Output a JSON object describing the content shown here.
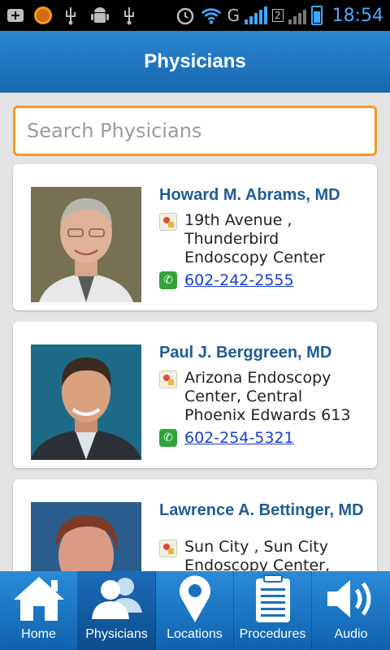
{
  "status_bar": {
    "time": "18:54",
    "network_label": "G",
    "sim_label": "2"
  },
  "header": {
    "title": "Physicians"
  },
  "search": {
    "placeholder": "Search Physicians",
    "value": ""
  },
  "physicians": [
    {
      "name": "Howard M. Abrams, MD",
      "address": "19th Avenue , Thunderbird Endoscopy Center",
      "phone": "602-242-2555"
    },
    {
      "name": "Paul J. Berggreen, MD",
      "address": "Arizona Endoscopy Center, Central Phoenix Edwards 613",
      "phone": "602-254-5321"
    },
    {
      "name": "Lawrence A. Bettinger, MD",
      "address": "Sun City , Sun City Endoscopy Center,",
      "phone": ""
    }
  ],
  "tabs": [
    {
      "label": "Home",
      "icon": "home-icon"
    },
    {
      "label": "Physicians",
      "icon": "people-icon"
    },
    {
      "label": "Locations",
      "icon": "location-pin-icon"
    },
    {
      "label": "Procedures",
      "icon": "clipboard-icon"
    },
    {
      "label": "Audio",
      "icon": "speaker-icon"
    }
  ],
  "colors": {
    "header": "#1f77c4",
    "search_border": "#f29a22",
    "name_text": "#1f5c96",
    "phone_link": "#1a3fcf",
    "status_time": "#4aa8ff"
  }
}
